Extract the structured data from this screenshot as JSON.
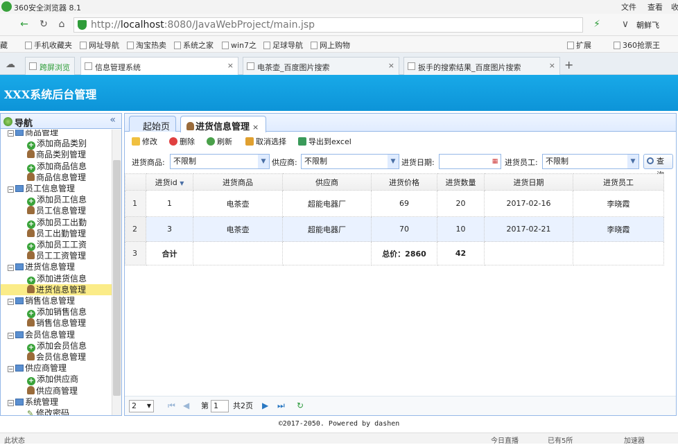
{
  "browser": {
    "title": "360安全浏览器 8.1",
    "menu": [
      "文件",
      "查看",
      "收"
    ],
    "url_host": "localhost",
    "url_rest": ":8080/JavaWebProject/main.jsp",
    "url_prefix": "http://",
    "account": "朝鲜飞",
    "bookmarks": [
      "藏",
      "手机收藏夹",
      "网址导航",
      "淘宝热卖",
      "系统之家",
      "win7之",
      "足球导航",
      "网上购物"
    ],
    "bookmark_right": [
      "扩展",
      "360抢票王"
    ],
    "tabs": [
      {
        "label": "跨屏浏览"
      },
      {
        "label": "信息管理系统"
      },
      {
        "label": "电茶壶_百度图片搜索"
      },
      {
        "label": "扳手的搜索结果_百度图片搜索"
      }
    ],
    "new_tab": "+",
    "status_left": "此状态",
    "status_right": [
      "今日直播",
      "已有5所",
      "加速器"
    ]
  },
  "app": {
    "title": "XXX系统后台管理",
    "footer": "©2017-2050. Powered by dashen"
  },
  "nav": {
    "title": "导航",
    "collapse": "«",
    "items": [
      {
        "label": "商品管理",
        "level": 0,
        "icon": "folder",
        "toggle": "⊟"
      },
      {
        "label": "添加商品类别",
        "level": 1,
        "icon": "add"
      },
      {
        "label": "商品类别管理",
        "level": 1,
        "icon": "user"
      },
      {
        "label": "添加商品信息",
        "level": 1,
        "icon": "add"
      },
      {
        "label": "商品信息管理",
        "level": 1,
        "icon": "user"
      },
      {
        "label": "员工信息管理",
        "level": 0,
        "icon": "folder",
        "toggle": "⊟"
      },
      {
        "label": "添加员工信息",
        "level": 1,
        "icon": "add"
      },
      {
        "label": "员工信息管理",
        "level": 1,
        "icon": "user"
      },
      {
        "label": "添加员工出勤",
        "level": 1,
        "icon": "add"
      },
      {
        "label": "员工出勤管理",
        "level": 1,
        "icon": "user"
      },
      {
        "label": "添加员工工资",
        "level": 1,
        "icon": "add"
      },
      {
        "label": "员工工资管理",
        "level": 1,
        "icon": "user"
      },
      {
        "label": "进货信息管理",
        "level": 0,
        "icon": "folder",
        "toggle": "⊟"
      },
      {
        "label": "添加进货信息",
        "level": 1,
        "icon": "add"
      },
      {
        "label": "进货信息管理",
        "level": 1,
        "icon": "user",
        "selected": true
      },
      {
        "label": "销售信息管理",
        "level": 0,
        "icon": "folder",
        "toggle": "⊟"
      },
      {
        "label": "添加销售信息",
        "level": 1,
        "icon": "add"
      },
      {
        "label": "销售信息管理",
        "level": 1,
        "icon": "user"
      },
      {
        "label": "会员信息管理",
        "level": 0,
        "icon": "folder",
        "toggle": "⊟"
      },
      {
        "label": "添加会员信息",
        "level": 1,
        "icon": "add"
      },
      {
        "label": "会员信息管理",
        "level": 1,
        "icon": "user"
      },
      {
        "label": "供应商管理",
        "level": 0,
        "icon": "folder",
        "toggle": "⊟"
      },
      {
        "label": "添加供应商",
        "level": 1,
        "icon": "add"
      },
      {
        "label": "供应商管理",
        "level": 1,
        "icon": "user"
      },
      {
        "label": "系统管理",
        "level": 0,
        "icon": "folder",
        "toggle": "⊟"
      },
      {
        "label": "修改密码",
        "level": 1,
        "icon": "pencil"
      }
    ]
  },
  "main": {
    "tabs": [
      {
        "label": "起始页",
        "active": false
      },
      {
        "label": "进货信息管理",
        "active": true,
        "close": "×"
      }
    ],
    "toolbar": {
      "edit": "修改",
      "delete": "删除",
      "refresh": "刷新",
      "unselect": "取消选择",
      "export": "导出到excel"
    },
    "filters": {
      "product_label": "进货商品:",
      "product_value": "不限制",
      "supplier_label": "供应商:",
      "supplier_value": "不限制",
      "date_label": "进货日期:",
      "date_value": "",
      "staff_label": "进货员工:",
      "staff_value": "不限制",
      "query": "查询"
    },
    "grid": {
      "columns": [
        "进货id",
        "进货商品",
        "供应商",
        "进货价格",
        "进货数量",
        "进货日期",
        "进货员工"
      ],
      "sort_indicator": "▼",
      "rows": [
        {
          "n": "1",
          "cells": [
            "1",
            "电茶壶",
            "超能电器厂",
            "69",
            "20",
            "2017-02-16",
            "李晓霞"
          ]
        },
        {
          "n": "2",
          "cells": [
            "3",
            "电茶壶",
            "超能电器厂",
            "70",
            "10",
            "2017-02-21",
            "李晓霞"
          ]
        }
      ],
      "total_row": {
        "n": "3",
        "label": "合计",
        "price": "总价：2860",
        "qty": "42"
      }
    },
    "pager": {
      "page_size": "2",
      "page_prefix": "第",
      "page": "1",
      "total": "共2页"
    }
  }
}
